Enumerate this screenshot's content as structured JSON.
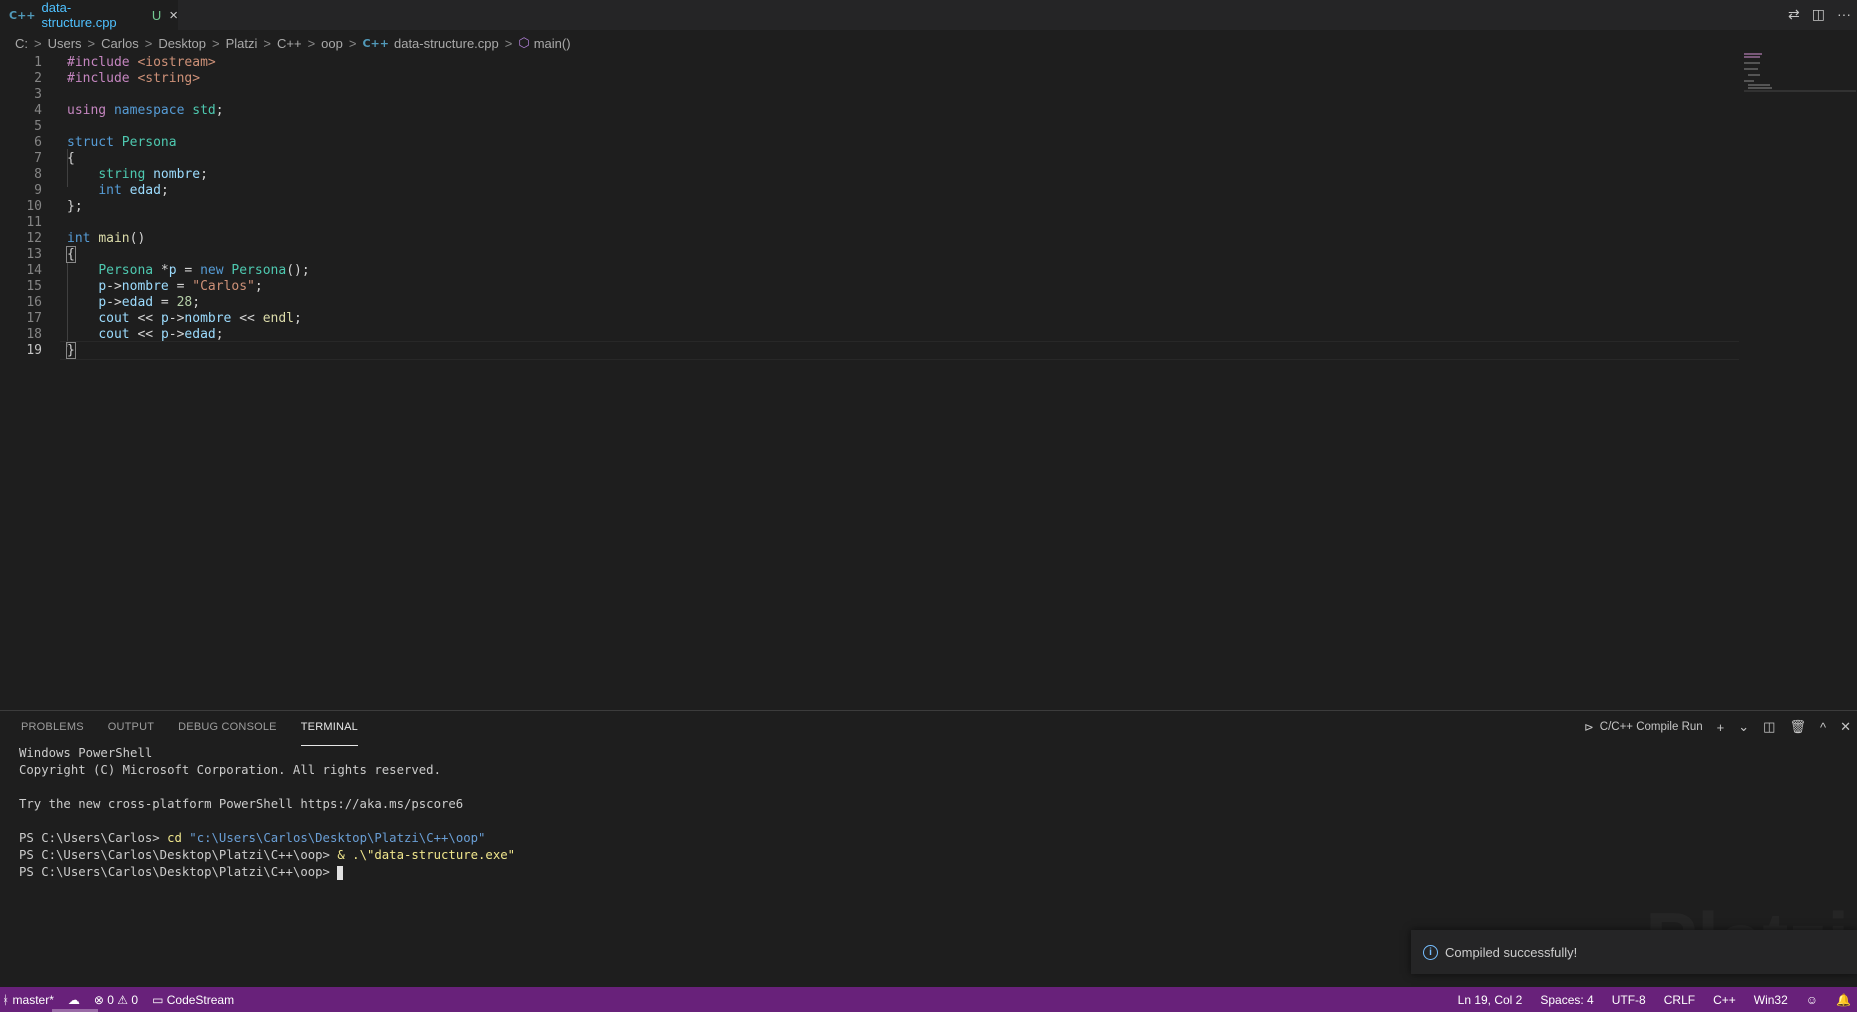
{
  "tab": {
    "icon": "C++",
    "filename": "data-structure.cpp",
    "status": "U",
    "close": "×"
  },
  "tab_actions": {
    "compare": "⇄",
    "split": "◫",
    "more": "···"
  },
  "breadcrumbs": [
    "C:",
    "Users",
    "Carlos",
    "Desktop",
    "Platzi",
    "C++",
    "oop"
  ],
  "breadcrumb_file": {
    "icon": "C++",
    "name": "data-structure.cpp"
  },
  "breadcrumb_symbol": {
    "icon": "⬡",
    "name": "main()"
  },
  "breadcrumb_sep": ">",
  "code": {
    "line_numbers": [
      "1",
      "2",
      "3",
      "4",
      "5",
      "6",
      "7",
      "8",
      "9",
      "10",
      "11",
      "12",
      "13",
      "14",
      "15",
      "16",
      "17",
      "18",
      "19"
    ],
    "l1": {
      "a": "#include",
      "b": " <iostream>"
    },
    "l2": {
      "a": "#include",
      "b": " <string>"
    },
    "l4": {
      "a": "using",
      "b": " ",
      "c": "namespace",
      "d": " ",
      "e": "std",
      "f": ";"
    },
    "l6": {
      "a": "struct",
      "b": " ",
      "c": "Persona"
    },
    "l7": {
      "a": "{"
    },
    "l8": {
      "a": "    ",
      "b": "string",
      "c": " ",
      "d": "nombre",
      "e": ";"
    },
    "l9": {
      "a": "    ",
      "b": "int",
      "c": " ",
      "d": "edad",
      "e": ";"
    },
    "l10": {
      "a": "};"
    },
    "l12": {
      "a": "int",
      "b": " ",
      "c": "main",
      "d": "()"
    },
    "l13": {
      "a": "{"
    },
    "l14": {
      "a": "    ",
      "b": "Persona",
      "c": " *",
      "d": "p",
      "e": " = ",
      "f": "new",
      "g": " ",
      "h": "Persona",
      "i": "();"
    },
    "l15": {
      "a": "    ",
      "b": "p",
      "c": "->",
      "d": "nombre",
      "e": " = ",
      "f": "\"Carlos\"",
      "g": ";"
    },
    "l16": {
      "a": "    ",
      "b": "p",
      "c": "->",
      "d": "edad",
      "e": " = ",
      "f": "28",
      "g": ";"
    },
    "l17": {
      "a": "    ",
      "b": "cout",
      "c": " << ",
      "d": "p",
      "e": "->",
      "f": "nombre",
      "g": " << ",
      "h": "endl",
      "i": ";"
    },
    "l18": {
      "a": "    ",
      "b": "cout",
      "c": " << ",
      "d": "p",
      "e": "->",
      "f": "edad",
      "g": ";"
    },
    "l19": {
      "a": "}"
    }
  },
  "panel": {
    "tabs": [
      "PROBLEMS",
      "OUTPUT",
      "DEBUG CONSOLE",
      "TERMINAL"
    ],
    "active_tab": "TERMINAL",
    "task_icon": "⊳",
    "task_label": "C/C++ Compile Run",
    "add": "+",
    "dropdown": "⌄",
    "split": "◫",
    "trash": "🗑",
    "maximize": "^",
    "close": "✕"
  },
  "terminal": {
    "l1": "Windows PowerShell",
    "l2": "Copyright (C) Microsoft Corporation. All rights reserved.",
    "l3": "Try the new cross-platform PowerShell https://aka.ms/pscore6",
    "l4_prompt": "PS C:\\Users\\Carlos> ",
    "l4_cmd": "cd ",
    "l4_arg": "\"c:\\Users\\Carlos\\Desktop\\Platzi\\C++\\oop\"",
    "l5_prompt": "PS C:\\Users\\Carlos\\Desktop\\Platzi\\C++\\oop> ",
    "l5_cmd": "& .\\\"data-structure.exe\"",
    "l6_prompt": "PS C:\\Users\\Carlos\\Desktop\\Platzi\\C++\\oop> "
  },
  "toast": {
    "icon": "i",
    "message": "Compiled successfully!"
  },
  "watermark": "Platzi",
  "status": {
    "branch": "ᚼ master*",
    "sync": "☁",
    "errors": "⊗ 0",
    "warnings": "⚠ 0",
    "codestream": "▭ CodeStream",
    "position": "Ln 19, Col 2",
    "spaces": "Spaces: 4",
    "encoding": "UTF-8",
    "eol": "CRLF",
    "language": "C++",
    "platform": "Win32",
    "feedback": "☺",
    "bell": "🔔"
  },
  "colors": {
    "statusbar": "#68217a",
    "tab_name": "#4fc1ff",
    "modified": "#73c991"
  }
}
